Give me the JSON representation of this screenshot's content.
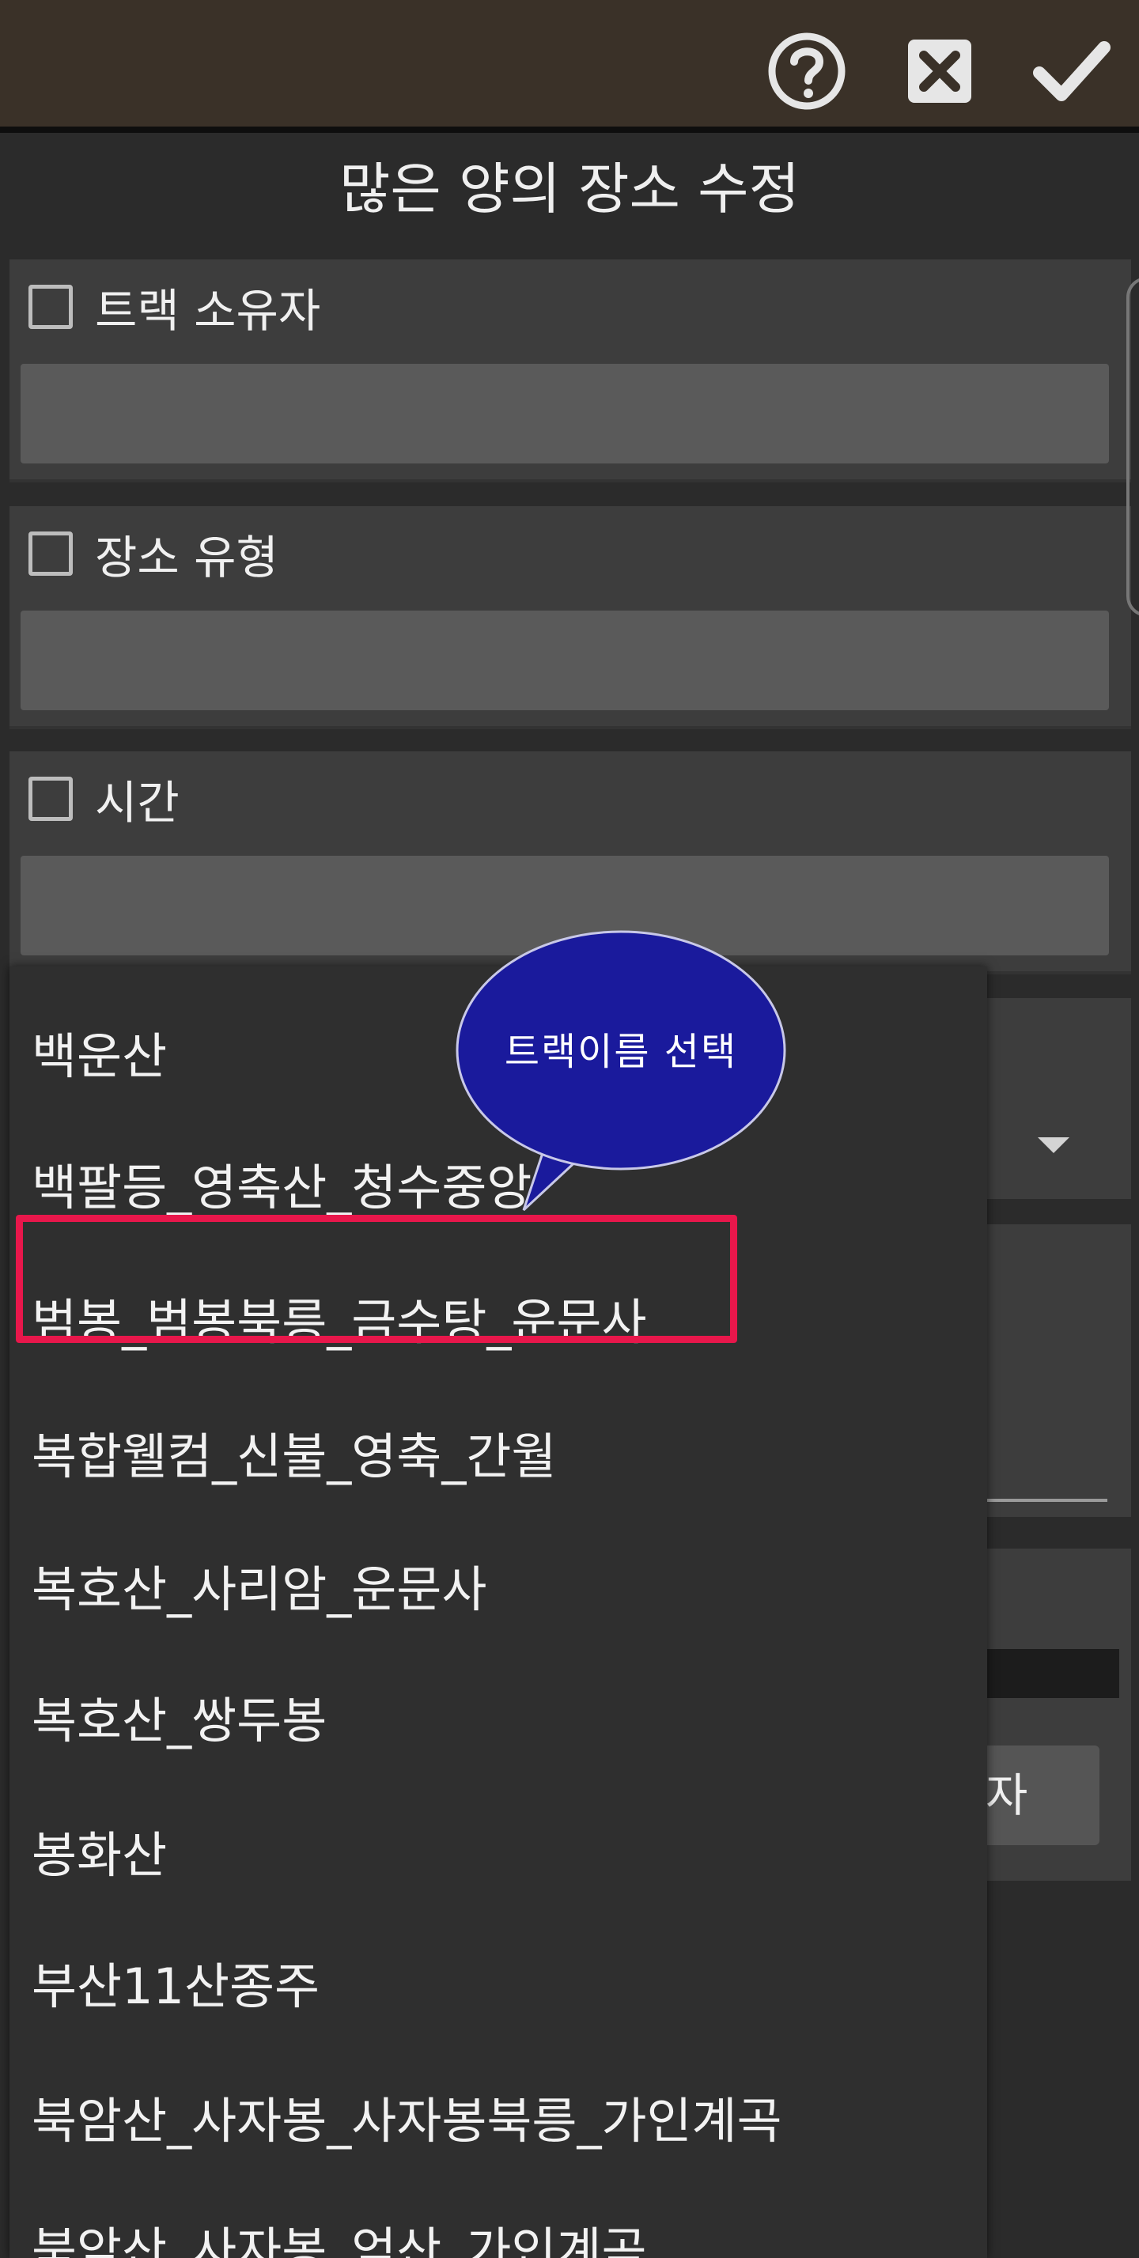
{
  "toolbar": {
    "help_icon": "help-circle-icon",
    "close_icon": "close-box-icon",
    "confirm_icon": "checkmark-icon"
  },
  "dialog": {
    "title": "많은 양의 장소 수정"
  },
  "panels": [
    {
      "label": "트랙 소유자",
      "checked": false
    },
    {
      "label": "장소 유형",
      "checked": false
    },
    {
      "label": "시간",
      "checked": false
    }
  ],
  "behind": {
    "partial_button_text": "자"
  },
  "dropdown": {
    "items": [
      "백운산",
      "백팔등_영축산_청수중앙",
      "범봉_범봉북릉_금수탕_운문사",
      "복합웰컴_신불_영축_간월",
      "복호산_사리암_운문사",
      "복호산_쌍두봉",
      "봉화산",
      "부산11산종주",
      "북암산_사자봉_사자봉북릉_가인계곡",
      "북암산_사자봉_억산_가인계곡"
    ],
    "highlighted_index": 2
  },
  "callout": {
    "text": "트랙이름 선택",
    "fill_color": "#1a1a9c",
    "border_color": "#c8c8e8"
  },
  "colors": {
    "highlight_border": "#e8174b",
    "topbar": "#3a3128"
  }
}
